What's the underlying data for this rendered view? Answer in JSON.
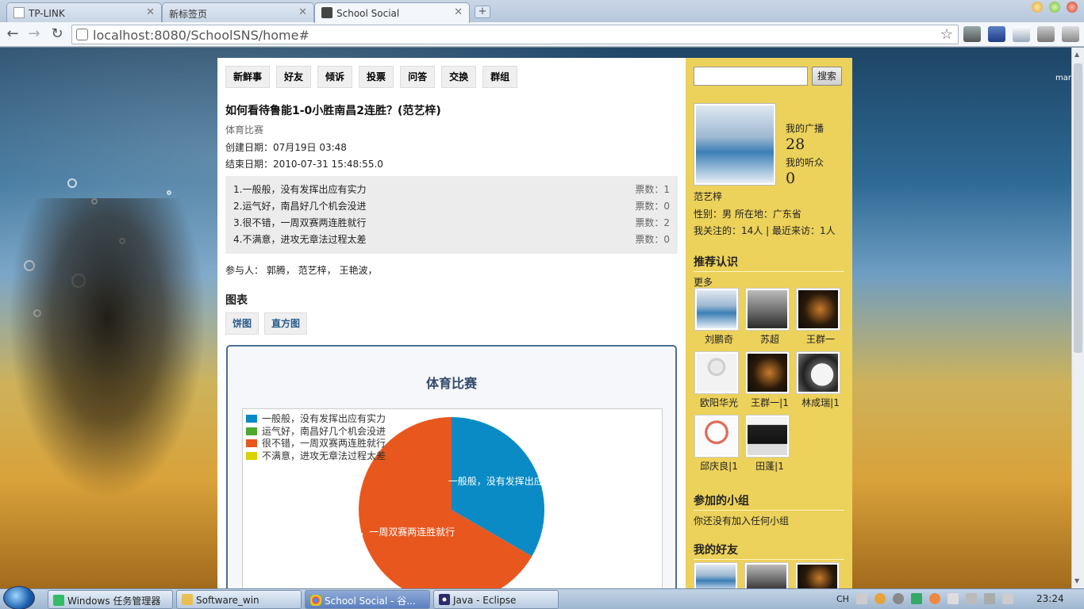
{
  "browser": {
    "tabs": [
      {
        "title": "TP-LINK",
        "active": false
      },
      {
        "title": "新标签页",
        "active": false
      },
      {
        "title": "School Social",
        "active": true
      }
    ],
    "url": "localhost:8080/SchoolSNS/home#"
  },
  "nav_tabs": [
    "新鲜事",
    "好友",
    "倾诉",
    "投票",
    "问答",
    "交换",
    "群组"
  ],
  "topic": {
    "title": "如何看待鲁能1-0小胜南昌2连胜？(范艺梓)",
    "category": "体育比赛",
    "created": "创建日期：07月19日 03:48",
    "ends": "结束日期：2010-07-31 15:48:55.0"
  },
  "options": [
    {
      "label": "1.一般般，没有发挥出应有实力",
      "count_text": "票数：1"
    },
    {
      "label": "2.运气好，南昌好几个机会没进",
      "count_text": "票数：0"
    },
    {
      "label": "3.很不错，一周双赛两连胜就行",
      "count_text": "票数：2"
    },
    {
      "label": "4.不满意，进攻无章法过程太差",
      "count_text": "票数：0"
    }
  ],
  "participants": "参与人： 郭腾， 范艺梓， 王艳波，",
  "chart_section": {
    "heading": "图表",
    "buttons": [
      "饼图",
      "直方图"
    ]
  },
  "chart_data": {
    "type": "pie",
    "title": "体育比赛",
    "categories": [
      "一般般，没有发挥出应有实力",
      "运气好，南昌好几个机会没进",
      "很不错，一周双赛两连胜就行",
      "不满意，进攻无章法过程太差"
    ],
    "values": [
      1,
      0,
      2,
      0
    ],
    "colors": [
      "#0a8bc5",
      "#4ca82f",
      "#e8571e",
      "#d9d400"
    ],
    "slice_labels": [
      "一般般，没有发挥出应",
      "，一周双赛两连胜就行"
    ],
    "legend_position": "top-left"
  },
  "sidebar": {
    "search_button": "搜索",
    "stats": [
      {
        "label": "我的广播",
        "value": "28"
      },
      {
        "label": "我的听众",
        "value": "0"
      }
    ],
    "username": "范艺梓",
    "info1": "性别：男 所在地：广东省",
    "info2": "我关注的：14人 | 最近来访：1人",
    "recommend_heading": "推荐认识",
    "more": "更多",
    "recommended": [
      {
        "name": "刘鹏奇",
        "photo": "ph-chimes"
      },
      {
        "name": "苏超",
        "photo": "ph-gray"
      },
      {
        "name": "王群一",
        "photo": "ph-dark"
      },
      {
        "name": "欧阳华光",
        "photo": "ph-person"
      },
      {
        "name": "王群一|1",
        "photo": "ph-dark"
      },
      {
        "name": "林成瑞|1",
        "photo": "ph-clock"
      },
      {
        "name": "邱庆良|1",
        "photo": "ph-snow"
      },
      {
        "name": "田蓬|1",
        "photo": "ph-piano"
      }
    ],
    "groups_heading": "参加的小组",
    "groups_empty": "你还没有加入任何小组",
    "friends_heading": "我的好友"
  },
  "page_wordmark": "mar",
  "taskbar": {
    "tasks": [
      {
        "label": "Windows 任务管理器",
        "active": false
      },
      {
        "label": "Software_win",
        "active": false
      },
      {
        "label": "School Social - 谷...",
        "active": true
      },
      {
        "label": "Java - Eclipse",
        "active": false
      }
    ],
    "lang": "CH",
    "time": "23:24"
  }
}
